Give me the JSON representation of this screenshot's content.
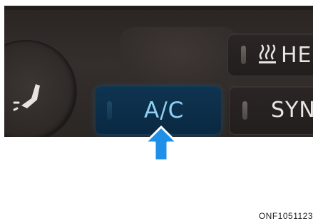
{
  "buttons": {
    "ac": {
      "label": "A/C",
      "active": true
    },
    "heat": {
      "label": "HE",
      "icon": "heated-seat-icon"
    },
    "sync": {
      "label": "SYN"
    }
  },
  "pointer": {
    "icon": "up-arrow-icon",
    "color": "#1e90e8"
  },
  "image_code": "ONF1051123",
  "colors": {
    "panel": "#2f2a28",
    "ac_active_bg": "#0d3049",
    "ac_text": "#8fd0f5"
  }
}
